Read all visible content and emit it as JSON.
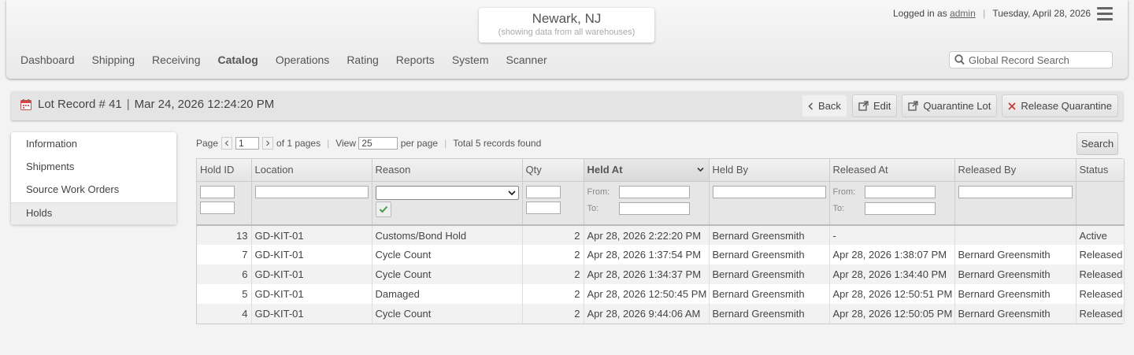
{
  "header": {
    "warehouse": "Newark, NJ",
    "warehouse_sub": "(showing data from all warehouses)",
    "logged_in_prefix": "Logged in as",
    "username": "admin",
    "date": "Tuesday, April 28, 2026",
    "search_placeholder": "Global Record Search",
    "nav": [
      "Dashboard",
      "Shipping",
      "Receiving",
      "Catalog",
      "Operations",
      "Rating",
      "Reports",
      "System",
      "Scanner"
    ],
    "active_nav": "Catalog"
  },
  "record": {
    "title_prefix": "Lot Record #",
    "id": "41",
    "timestamp": "Mar 24, 2026 12:24:20 PM",
    "buttons": {
      "back": "Back",
      "edit": "Edit",
      "quarantine": "Quarantine Lot",
      "release": "Release Quarantine"
    }
  },
  "sidebar": {
    "items": [
      "Information",
      "Shipments",
      "Source Work Orders",
      "Holds"
    ],
    "active": "Holds"
  },
  "pager": {
    "page_label": "Page",
    "page": "1",
    "of_pages": "of 1 pages",
    "view_label": "View",
    "per_page": "25",
    "per_page_label": "per page",
    "total": "Total 5 records found",
    "search_button": "Search"
  },
  "grid": {
    "columns": [
      "Hold ID",
      "Location",
      "Reason",
      "Qty",
      "Held At",
      "Held By",
      "Released At",
      "Released By",
      "Status"
    ],
    "sorted_column": "Held At",
    "filter_from": "From:",
    "filter_to": "To:",
    "rows": [
      {
        "hold_id": "13",
        "location": "GD-KIT-01",
        "reason": "Customs/Bond Hold",
        "qty": "2",
        "held_at": "Apr 28, 2026 2:22:20 PM",
        "held_by": "Bernard Greensmith",
        "released_at": "-",
        "released_by": "",
        "status": "Active"
      },
      {
        "hold_id": "7",
        "location": "GD-KIT-01",
        "reason": "Cycle Count",
        "qty": "2",
        "held_at": "Apr 28, 2026 1:37:54 PM",
        "held_by": "Bernard Greensmith",
        "released_at": "Apr 28, 2026 1:38:07 PM",
        "released_by": "Bernard Greensmith",
        "status": "Released"
      },
      {
        "hold_id": "6",
        "location": "GD-KIT-01",
        "reason": "Cycle Count",
        "qty": "2",
        "held_at": "Apr 28, 2026 1:34:37 PM",
        "held_by": "Bernard Greensmith",
        "released_at": "Apr 28, 2026 1:34:40 PM",
        "released_by": "Bernard Greensmith",
        "status": "Released"
      },
      {
        "hold_id": "5",
        "location": "GD-KIT-01",
        "reason": "Damaged",
        "qty": "2",
        "held_at": "Apr 28, 2026 12:50:45 PM",
        "held_by": "Bernard Greensmith",
        "released_at": "Apr 28, 2026 12:50:51 PM",
        "released_by": "Bernard Greensmith",
        "status": "Released"
      },
      {
        "hold_id": "4",
        "location": "GD-KIT-01",
        "reason": "Cycle Count",
        "qty": "2",
        "held_at": "Apr 28, 2026 9:44:06 AM",
        "held_by": "Bernard Greensmith",
        "released_at": "Apr 28, 2026 12:50:05 PM",
        "released_by": "Bernard Greensmith",
        "status": "Released"
      }
    ]
  }
}
